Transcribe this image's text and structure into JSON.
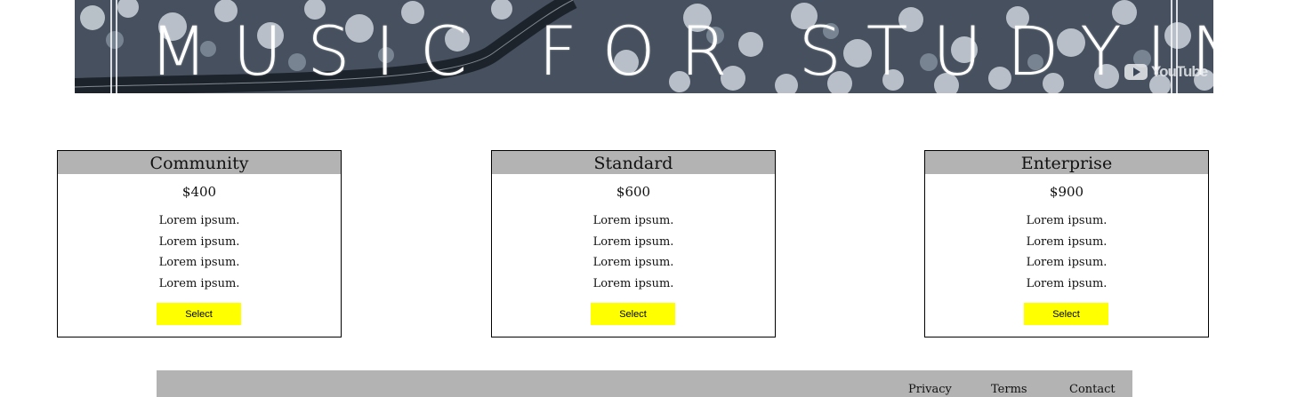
{
  "hero": {
    "title": "MUSIC FOR STUDYING",
    "badge_text": "YouTube",
    "badge_icon": "youtube-play-icon"
  },
  "plans": [
    {
      "name": "Community",
      "price": "$400",
      "features": [
        "Lorem ipsum.",
        "Lorem ipsum.",
        "Lorem ipsum.",
        "Lorem ipsum."
      ],
      "button_label": "Select"
    },
    {
      "name": "Standard",
      "price": "$600",
      "features": [
        "Lorem ipsum.",
        "Lorem ipsum.",
        "Lorem ipsum.",
        "Lorem ipsum."
      ],
      "button_label": "Select"
    },
    {
      "name": "Enterprise",
      "price": "$900",
      "features": [
        "Lorem ipsum.",
        "Lorem ipsum.",
        "Lorem ipsum.",
        "Lorem ipsum."
      ],
      "button_label": "Select"
    }
  ],
  "footer": {
    "links": [
      "Privacy",
      "Terms",
      "Contact"
    ]
  },
  "colors": {
    "card_header_bg": "#b3b3b3",
    "button_bg": "#ffff00",
    "footer_bg": "#b3b3b3",
    "hero_bg": "#3a4657"
  }
}
